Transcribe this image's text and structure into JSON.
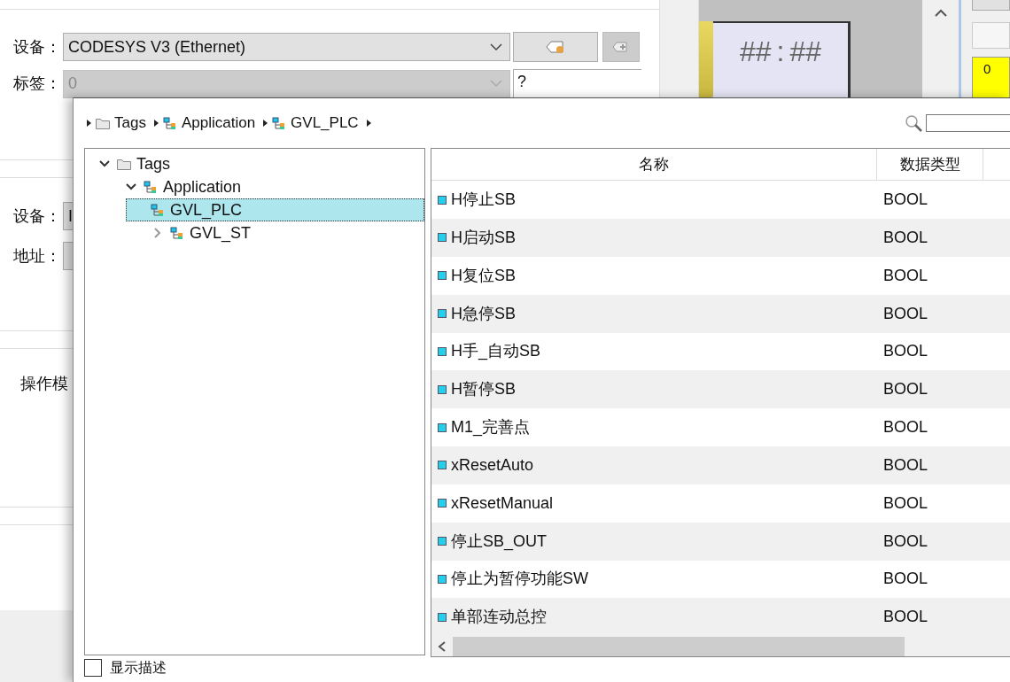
{
  "background_dialog": {
    "device_label": "设备：",
    "device_select": "CODESYS V3 (Ethernet)",
    "tag_label": "标签：",
    "tag_select": {
      "value": "0",
      "disabled": true
    },
    "tag_field": "?",
    "device_label_2": "设备：",
    "device_field_2": "I",
    "address_label": "地址：",
    "operation_mode_label": "操作模"
  },
  "hmi_preview": {
    "clock_hours": "##",
    "clock_separator": ":",
    "clock_minutes": "##",
    "value_display": "0"
  },
  "tag_browser": {
    "breadcrumb": [
      {
        "label": "Tags",
        "kind": "folder"
      },
      {
        "label": "Application",
        "kind": "application"
      },
      {
        "label": "GVL_PLC",
        "kind": "application"
      }
    ],
    "tree": [
      {
        "label": "Tags",
        "kind": "folder",
        "expanded": true,
        "selected": false,
        "children": [
          {
            "label": "Application",
            "kind": "application",
            "expanded": true,
            "selected": false,
            "children": [
              {
                "label": "GVL_PLC",
                "kind": "application",
                "selected": true
              },
              {
                "label": "GVL_ST",
                "kind": "application",
                "expanded": false,
                "selected": false
              }
            ]
          }
        ]
      }
    ],
    "table": {
      "columns": [
        "名称",
        "数据类型"
      ],
      "rows": [
        {
          "name": "H停止SB",
          "type": "BOOL"
        },
        {
          "name": "H启动SB",
          "type": "BOOL"
        },
        {
          "name": "H复位SB",
          "type": "BOOL"
        },
        {
          "name": "H急停SB",
          "type": "BOOL"
        },
        {
          "name": "H手_自动SB",
          "type": "BOOL"
        },
        {
          "name": "H暂停SB",
          "type": "BOOL"
        },
        {
          "name": "M1_完善点",
          "type": "BOOL"
        },
        {
          "name": "xResetAuto",
          "type": "BOOL"
        },
        {
          "name": "xResetManual",
          "type": "BOOL"
        },
        {
          "name": "停止SB_OUT",
          "type": "BOOL"
        },
        {
          "name": "停止为暂停功能SW",
          "type": "BOOL"
        },
        {
          "name": "单部连动总控",
          "type": "BOOL"
        }
      ]
    },
    "show_description": {
      "label": "显示描述",
      "checked": false
    }
  }
}
